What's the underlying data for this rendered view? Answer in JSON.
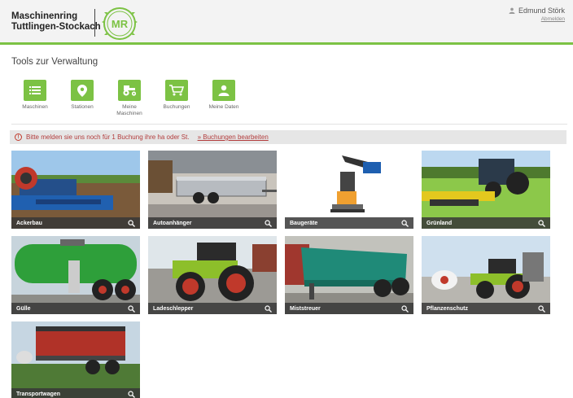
{
  "header": {
    "brand_line1": "Maschinenring",
    "brand_line2": "Tuttlingen-Stockach",
    "logo_text": "MR",
    "user_name": "Edmund Störk",
    "logout_label": "Abmelden",
    "accent_color": "#7cc244"
  },
  "tools_section": {
    "title": "Tools zur Verwaltung",
    "tools": [
      {
        "label_line1": "Maschinen",
        "label_line2": "",
        "icon": "list-icon"
      },
      {
        "label_line1": "Stationen",
        "label_line2": "",
        "icon": "location-pin-icon"
      },
      {
        "label_line1": "Meine",
        "label_line2": "Maschinen",
        "icon": "tractor-icon"
      },
      {
        "label_line1": "Buchungen",
        "label_line2": "",
        "icon": "cart-icon"
      },
      {
        "label_line1": "Meine Daten",
        "label_line2": "",
        "icon": "user-icon"
      }
    ]
  },
  "notice": {
    "text": "Bitte melden sie uns noch für 1 Buchung ihre ha oder St.",
    "link_label": "» Buchungen bearbeiten",
    "color": "#b23c3c"
  },
  "categories": [
    {
      "label": "Ackerbau"
    },
    {
      "label": "Autoanhänger"
    },
    {
      "label": "Baugeräte"
    },
    {
      "label": "Grünland"
    },
    {
      "label": "Gülle"
    },
    {
      "label": "Ladeschlepper"
    },
    {
      "label": "Miststreuer"
    },
    {
      "label": "Pflanzenschutz"
    },
    {
      "label": "Transportwagen"
    }
  ]
}
